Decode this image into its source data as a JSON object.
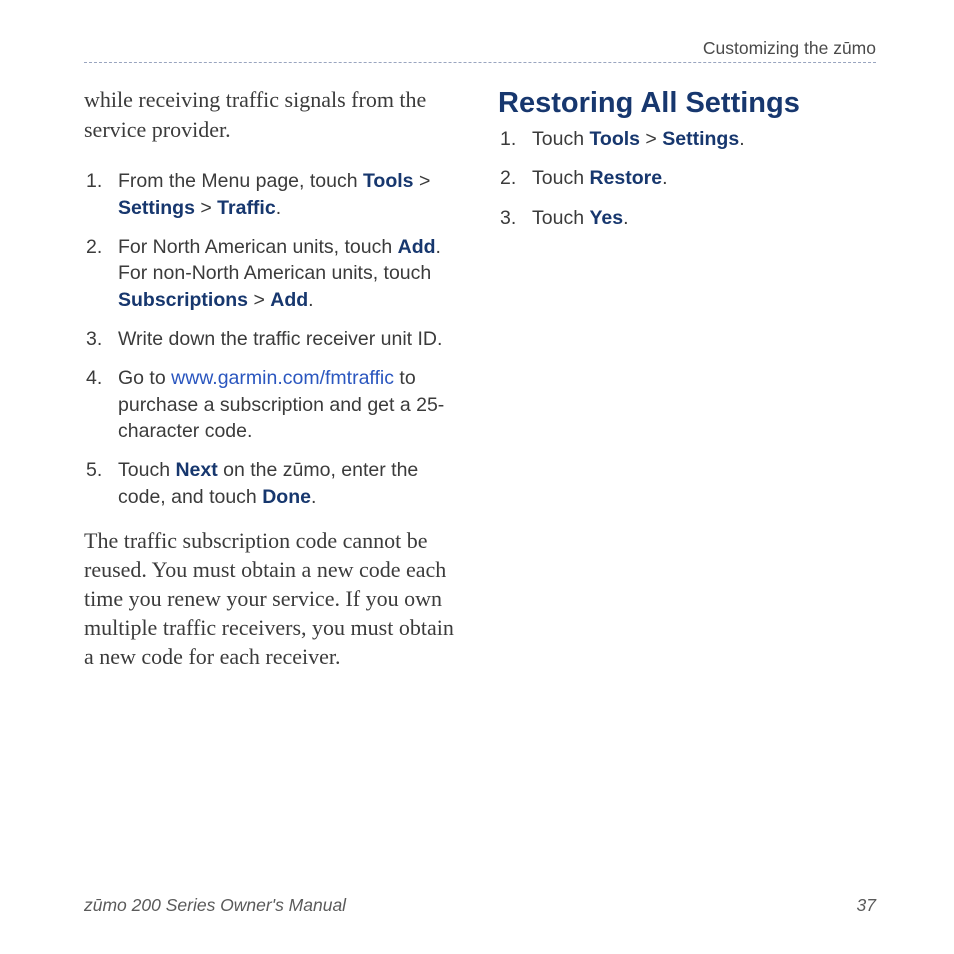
{
  "section_header": "Customizing the zūmo",
  "left": {
    "intro": "while receiving traffic signals from the service provider.",
    "steps": {
      "s1": {
        "pre": "From the Menu page, touch ",
        "b1": "Tools",
        "sep1": " > ",
        "b2": "Settings",
        "sep2": " > ",
        "b3": "Traffic",
        "post": "."
      },
      "s2": {
        "pre": "For North American units, touch ",
        "b1": "Add",
        "mid": ". For non-North American units, touch ",
        "b2": "Subscriptions",
        "sep": " > ",
        "b3": "Add",
        "post": "."
      },
      "s3": "Write down the traffic receiver unit ID.",
      "s4": {
        "pre": "Go to ",
        "link": "www.garmin.com/fmtraffic",
        "post": " to purchase a subscription and get a 25-character code."
      },
      "s5": {
        "pre": "Touch ",
        "b1": "Next",
        "mid": " on the zūmo, enter the code, and touch ",
        "b2": "Done",
        "post": "."
      }
    },
    "closing": "The traffic subscription code cannot be reused. You must obtain a new code each time you renew your service. If you own multiple traffic receivers, you must obtain a new code for each receiver."
  },
  "right": {
    "heading": "Restoring All Settings",
    "steps": {
      "s1": {
        "pre": "Touch ",
        "b1": "Tools",
        "sep": " > ",
        "b2": "Settings",
        "post": "."
      },
      "s2": {
        "pre": "Touch ",
        "b1": "Restore",
        "post": "."
      },
      "s3": {
        "pre": "Touch ",
        "b1": "Yes",
        "post": "."
      }
    }
  },
  "footer": {
    "title": "zūmo 200 Series Owner's Manual",
    "page": "37"
  }
}
